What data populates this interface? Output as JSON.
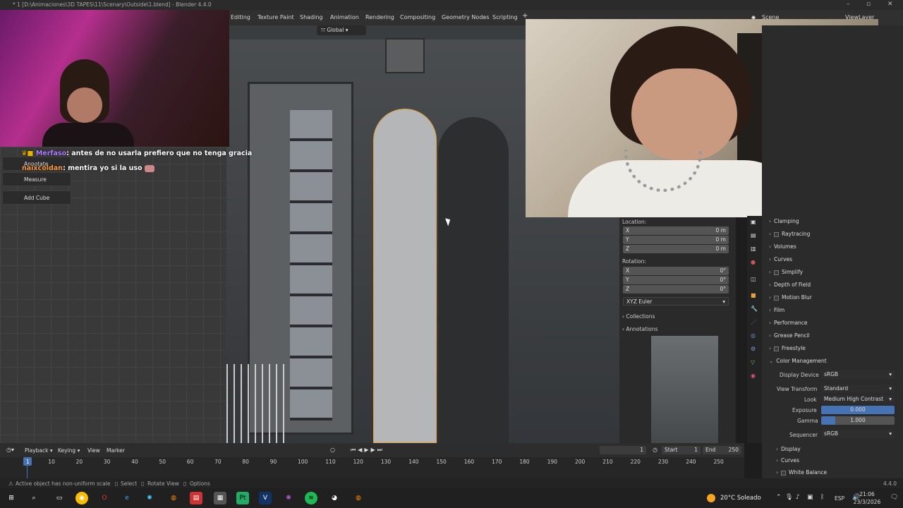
{
  "window": {
    "title": "* 1 [D:\\Animaciones\\3D TAPES\\11\\Scenary\\Outside\\1.blend] - Blender 4.4.0"
  },
  "workspace_tabs": [
    "Editing",
    "Texture Paint",
    "Shading",
    "Animation",
    "Rendering",
    "Compositing",
    "Geometry Nodes",
    "Scripting"
  ],
  "header": {
    "orientation": "Global",
    "scene": "Scene",
    "view_layer": "ViewLayer"
  },
  "chat": [
    {
      "user": "Merfaso",
      "message": "antes de no usarla prefiero que no tenga gracia",
      "color": "#b07cff"
    },
    {
      "user": "naixcoldan",
      "message": "mentira yo si la uso",
      "color": "#ff9a3c"
    }
  ],
  "tools": [
    "Annotate",
    "Measure",
    "Add Cube"
  ],
  "transform": {
    "location_label": "Location:",
    "location": [
      {
        "axis": "X",
        "value": "0 m"
      },
      {
        "axis": "Y",
        "value": "0 m"
      },
      {
        "axis": "Z",
        "value": "0 m"
      }
    ],
    "rotation_label": "Rotation:",
    "rotation": [
      {
        "axis": "X",
        "value": "0°"
      },
      {
        "axis": "Y",
        "value": "0°"
      },
      {
        "axis": "Z",
        "value": "0°"
      }
    ],
    "rotation_mode": "XYZ Euler",
    "collections": "Collections",
    "annotations": "Annotations"
  },
  "render_sections": [
    {
      "label": "Clamping",
      "checkbox": false
    },
    {
      "label": "Raytracing",
      "checkbox": true
    },
    {
      "label": "Volumes",
      "checkbox": false
    },
    {
      "label": "Curves",
      "checkbox": false
    },
    {
      "label": "Simplify",
      "checkbox": true
    },
    {
      "label": "Depth of Field",
      "checkbox": false
    },
    {
      "label": "Motion Blur",
      "checkbox": true
    },
    {
      "label": "Film",
      "checkbox": false
    },
    {
      "label": "Performance",
      "checkbox": false
    },
    {
      "label": "Grease Pencil",
      "checkbox": false
    },
    {
      "label": "Freestyle",
      "checkbox": true
    }
  ],
  "color_management": {
    "title": "Color Management",
    "display_device_label": "Display Device",
    "display_device": "sRGB",
    "view_transform_label": "View Transform",
    "view_transform": "Standard",
    "look_label": "Look",
    "look": "Medium High Contrast",
    "exposure_label": "Exposure",
    "exposure": "0.000",
    "gamma_label": "Gamma",
    "gamma": "1.000",
    "sequencer_label": "Sequencer",
    "sequencer": "sRGB",
    "sub": [
      "Display",
      "Curves",
      "White Balance"
    ]
  },
  "timeline": {
    "menus": [
      "Playback",
      "Keying",
      "View",
      "Marker"
    ],
    "current_frame": "1",
    "start_label": "Start",
    "start": "1",
    "end_label": "End",
    "end": "250",
    "frame_marks": [
      "1",
      "10",
      "20",
      "30",
      "40",
      "50",
      "60",
      "70",
      "80",
      "90",
      "100",
      "110",
      "120",
      "130",
      "140",
      "150",
      "160",
      "170",
      "180",
      "190",
      "200",
      "210",
      "220",
      "230",
      "240",
      "250"
    ]
  },
  "status": {
    "message": "Active object has non-uniform scale",
    "hints": [
      "Select",
      "Rotate View",
      "Options"
    ],
    "version": "4.4.0"
  },
  "taskbar": {
    "weather": "20°C  Soleado",
    "language": "ESP",
    "time": "21:06",
    "date": "23/3/2026"
  },
  "colors": {
    "accent": "#4772b3",
    "selection": "#e8a040",
    "panel": "#2b2b2b"
  }
}
